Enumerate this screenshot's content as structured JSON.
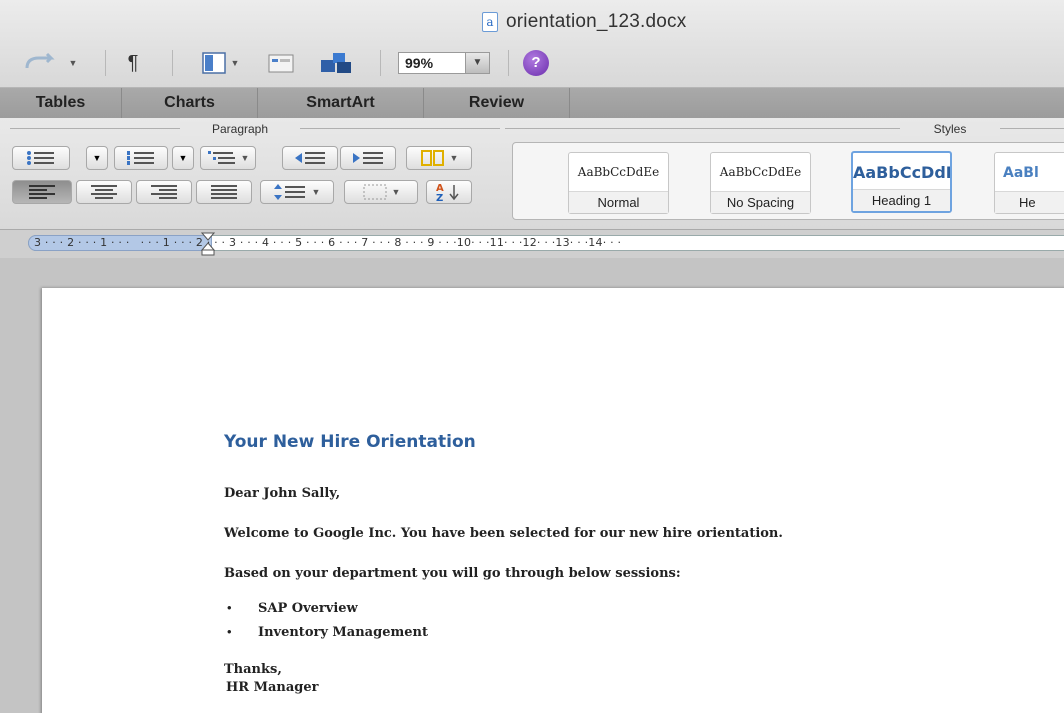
{
  "window": {
    "title": "orientation_123.docx",
    "doc_icon_glyph": "a"
  },
  "toolbar": {
    "pilcrow": "¶",
    "zoom_value": "99%",
    "help_glyph": "?"
  },
  "ribbon_tabs": [
    "Tables",
    "Charts",
    "SmartArt",
    "Review"
  ],
  "ribbon": {
    "paragraph_group_label": "Paragraph",
    "styles_group_label": "Styles",
    "styles": [
      {
        "sample": "AaBbCcDdEe",
        "name": "Normal"
      },
      {
        "sample": "AaBbCcDdEe",
        "name": "No Spacing"
      },
      {
        "sample": "AaBbCcDdI",
        "name": "Heading 1"
      },
      {
        "sample": "AaBl",
        "name": "He"
      }
    ]
  },
  "ruler": {
    "numbers": "3 · · · 2 · · · 1 · · ·   · · · 1 · · · 2 · · · 3 · · · 4 · · · 5 · · · 6 · · · 7 · · · 8 · · · 9 · · ·10· · ·11· · ·12· · ·13· · ·14· · ·"
  },
  "document": {
    "heading": "Your New Hire Orientation",
    "salutation": "Dear John Sally,",
    "para1": "Welcome to Google Inc. You have been selected for our new hire orientation.",
    "para2": "Based on your department you will go through below sessions:",
    "bullets": [
      "SAP Overview",
      "Inventory Management"
    ],
    "bullet_glyph": "•",
    "closing1": "Thanks,",
    "closing2": "HR Manager"
  },
  "colors": {
    "heading": "#2e5f9c",
    "style_selected_border": "#6ea3e0"
  }
}
